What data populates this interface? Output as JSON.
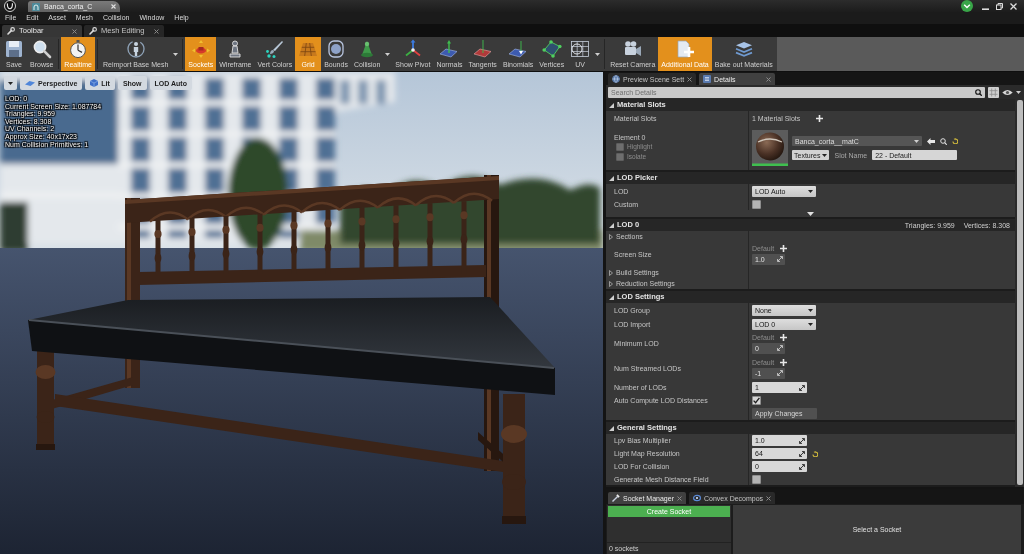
{
  "window": {
    "document_tab": {
      "label": "Banca_corta_C",
      "selected": true
    }
  },
  "menu": [
    "File",
    "Edit",
    "Asset",
    "Mesh",
    "Collision",
    "Window",
    "Help"
  ],
  "toolbar_tabs": [
    {
      "label": "Toolbar",
      "selected": true
    },
    {
      "label": "Mesh Editing",
      "selected": false
    }
  ],
  "toolbar": [
    {
      "buttons": [
        {
          "label": "Save",
          "on": false,
          "dropdown": false
        },
        {
          "label": "Browse",
          "on": false,
          "dropdown": false
        }
      ]
    },
    {
      "buttons": [
        {
          "label": "Realtime",
          "on": true,
          "dropdown": false
        }
      ]
    },
    {
      "buttons": [
        {
          "label": "Reimport Base Mesh",
          "on": false,
          "dropdown": true
        }
      ]
    },
    {
      "buttons": [
        {
          "label": "Sockets",
          "on": true,
          "dropdown": false
        },
        {
          "label": "Wireframe",
          "on": false,
          "dropdown": false
        },
        {
          "label": "Vert Colors",
          "on": false,
          "dropdown": false
        },
        {
          "label": "Grid",
          "on": true,
          "dropdown": false
        },
        {
          "label": "Bounds",
          "on": false,
          "dropdown": false
        },
        {
          "label": "Collision",
          "on": false,
          "dropdown": true
        },
        {
          "label": "Show Pivot",
          "on": false,
          "dropdown": false
        },
        {
          "label": "Normals",
          "on": false,
          "dropdown": false
        },
        {
          "label": "Tangents",
          "on": false,
          "dropdown": false
        },
        {
          "label": "Binomials",
          "on": false,
          "dropdown": false
        },
        {
          "label": "Vertices",
          "on": false,
          "dropdown": false
        },
        {
          "label": "UV",
          "on": false,
          "dropdown": true
        }
      ]
    },
    {
      "buttons": [
        {
          "label": "Reset Camera",
          "on": false,
          "dropdown": false
        },
        {
          "label": "Additional Data",
          "on": true,
          "dropdown": false
        },
        {
          "label": "Bake out Materials",
          "on": false,
          "dropdown": false
        }
      ]
    }
  ],
  "viewport": {
    "buttons": [
      {
        "label": "Perspective"
      },
      {
        "label": "Lit"
      },
      {
        "label": "Show"
      },
      {
        "label": "LOD Auto"
      }
    ],
    "stats": [
      "LOD: 0",
      "Current Screen Size: 1.087784",
      "Triangles: 9.959",
      "Vertices: 8.308",
      "UV Channels: 2",
      "Approx Size: 40x17x23",
      "Num Collision Primitives: 1"
    ]
  },
  "details": {
    "tabs": [
      {
        "label": "Preview Scene Sett",
        "selected": false
      },
      {
        "label": "Details",
        "selected": true
      }
    ],
    "search": {
      "placeholder": "Search Details"
    },
    "sections": [
      {
        "title": "Material Slots",
        "expanded": true,
        "rows": [
          {
            "kind": "info",
            "label": "Material Slots",
            "value": "1 Material Slots",
            "add": true
          },
          {
            "kind": "material",
            "label": "Element 0",
            "options": [
              {
                "label": "Highlight",
                "checked": false
              },
              {
                "label": "Isolate",
                "checked": false
              }
            ],
            "asset": "Banca_corta__matC",
            "reset": true,
            "filter": "Textures",
            "slot_label": "Slot Name",
            "slot_value": "22 - Default"
          }
        ]
      },
      {
        "title": "LOD Picker",
        "expanded": true,
        "rows": [
          {
            "kind": "dropdown",
            "label": "LOD",
            "value": "LOD Auto"
          },
          {
            "kind": "checkbox",
            "label": "Custom",
            "checked": false
          },
          {
            "kind": "advanced",
            "expanded": false
          }
        ]
      },
      {
        "title": "LOD 0",
        "expanded": true,
        "stats": [
          "Triangles: 9.959",
          "Vertices: 8.308"
        ],
        "rows": [
          {
            "kind": "group",
            "label": "Sections",
            "expanded": false
          },
          {
            "kind": "number",
            "label": "Screen Size",
            "value": "1.0",
            "disabled": true,
            "reset": false,
            "default_label": "Default"
          },
          {
            "kind": "group",
            "label": "Build Settings",
            "expanded": false
          },
          {
            "kind": "group",
            "label": "Reduction Settings",
            "expanded": false
          }
        ]
      },
      {
        "title": "LOD Settings",
        "expanded": true,
        "rows": [
          {
            "kind": "dropdown",
            "label": "LOD Group",
            "value": "None"
          },
          {
            "kind": "dropdown",
            "label": "LOD Import",
            "value": "LOD 0"
          },
          {
            "kind": "number",
            "label": "Minimum LOD",
            "value": "0",
            "disabled": true,
            "reset": false,
            "default_label": "Default"
          },
          {
            "kind": "number",
            "label": "Num Streamed LODs",
            "value": "-1",
            "disabled": true,
            "reset": false,
            "default_label": "Default"
          },
          {
            "kind": "number",
            "label": "Number of LODs",
            "value": "1",
            "disabled": false,
            "reset": false
          },
          {
            "kind": "checkbox",
            "label": "Auto Compute LOD Distances",
            "checked": true
          },
          {
            "kind": "button",
            "label": "Apply Changes",
            "disabled": true
          }
        ]
      },
      {
        "title": "General Settings",
        "expanded": true,
        "rows": [
          {
            "kind": "number",
            "label": "Lpv Bias Multiplier",
            "value": "1.0",
            "disabled": false,
            "reset": false
          },
          {
            "kind": "number",
            "label": "Light Map Resolution",
            "value": "64",
            "disabled": false,
            "reset": true
          },
          {
            "kind": "number",
            "label": "LOD For Collision",
            "value": "0",
            "disabled": false,
            "reset": false
          },
          {
            "kind": "checkbox",
            "label": "Generate Mesh Distance Field",
            "checked": false
          }
        ]
      }
    ]
  },
  "socket_panel": {
    "tabs": [
      {
        "label": "Socket Manager",
        "selected": true
      },
      {
        "label": "Convex Decompos",
        "selected": false
      }
    ],
    "create_button": "Create Socket",
    "count": "0 sockets",
    "empty_message": "Select a Socket"
  }
}
